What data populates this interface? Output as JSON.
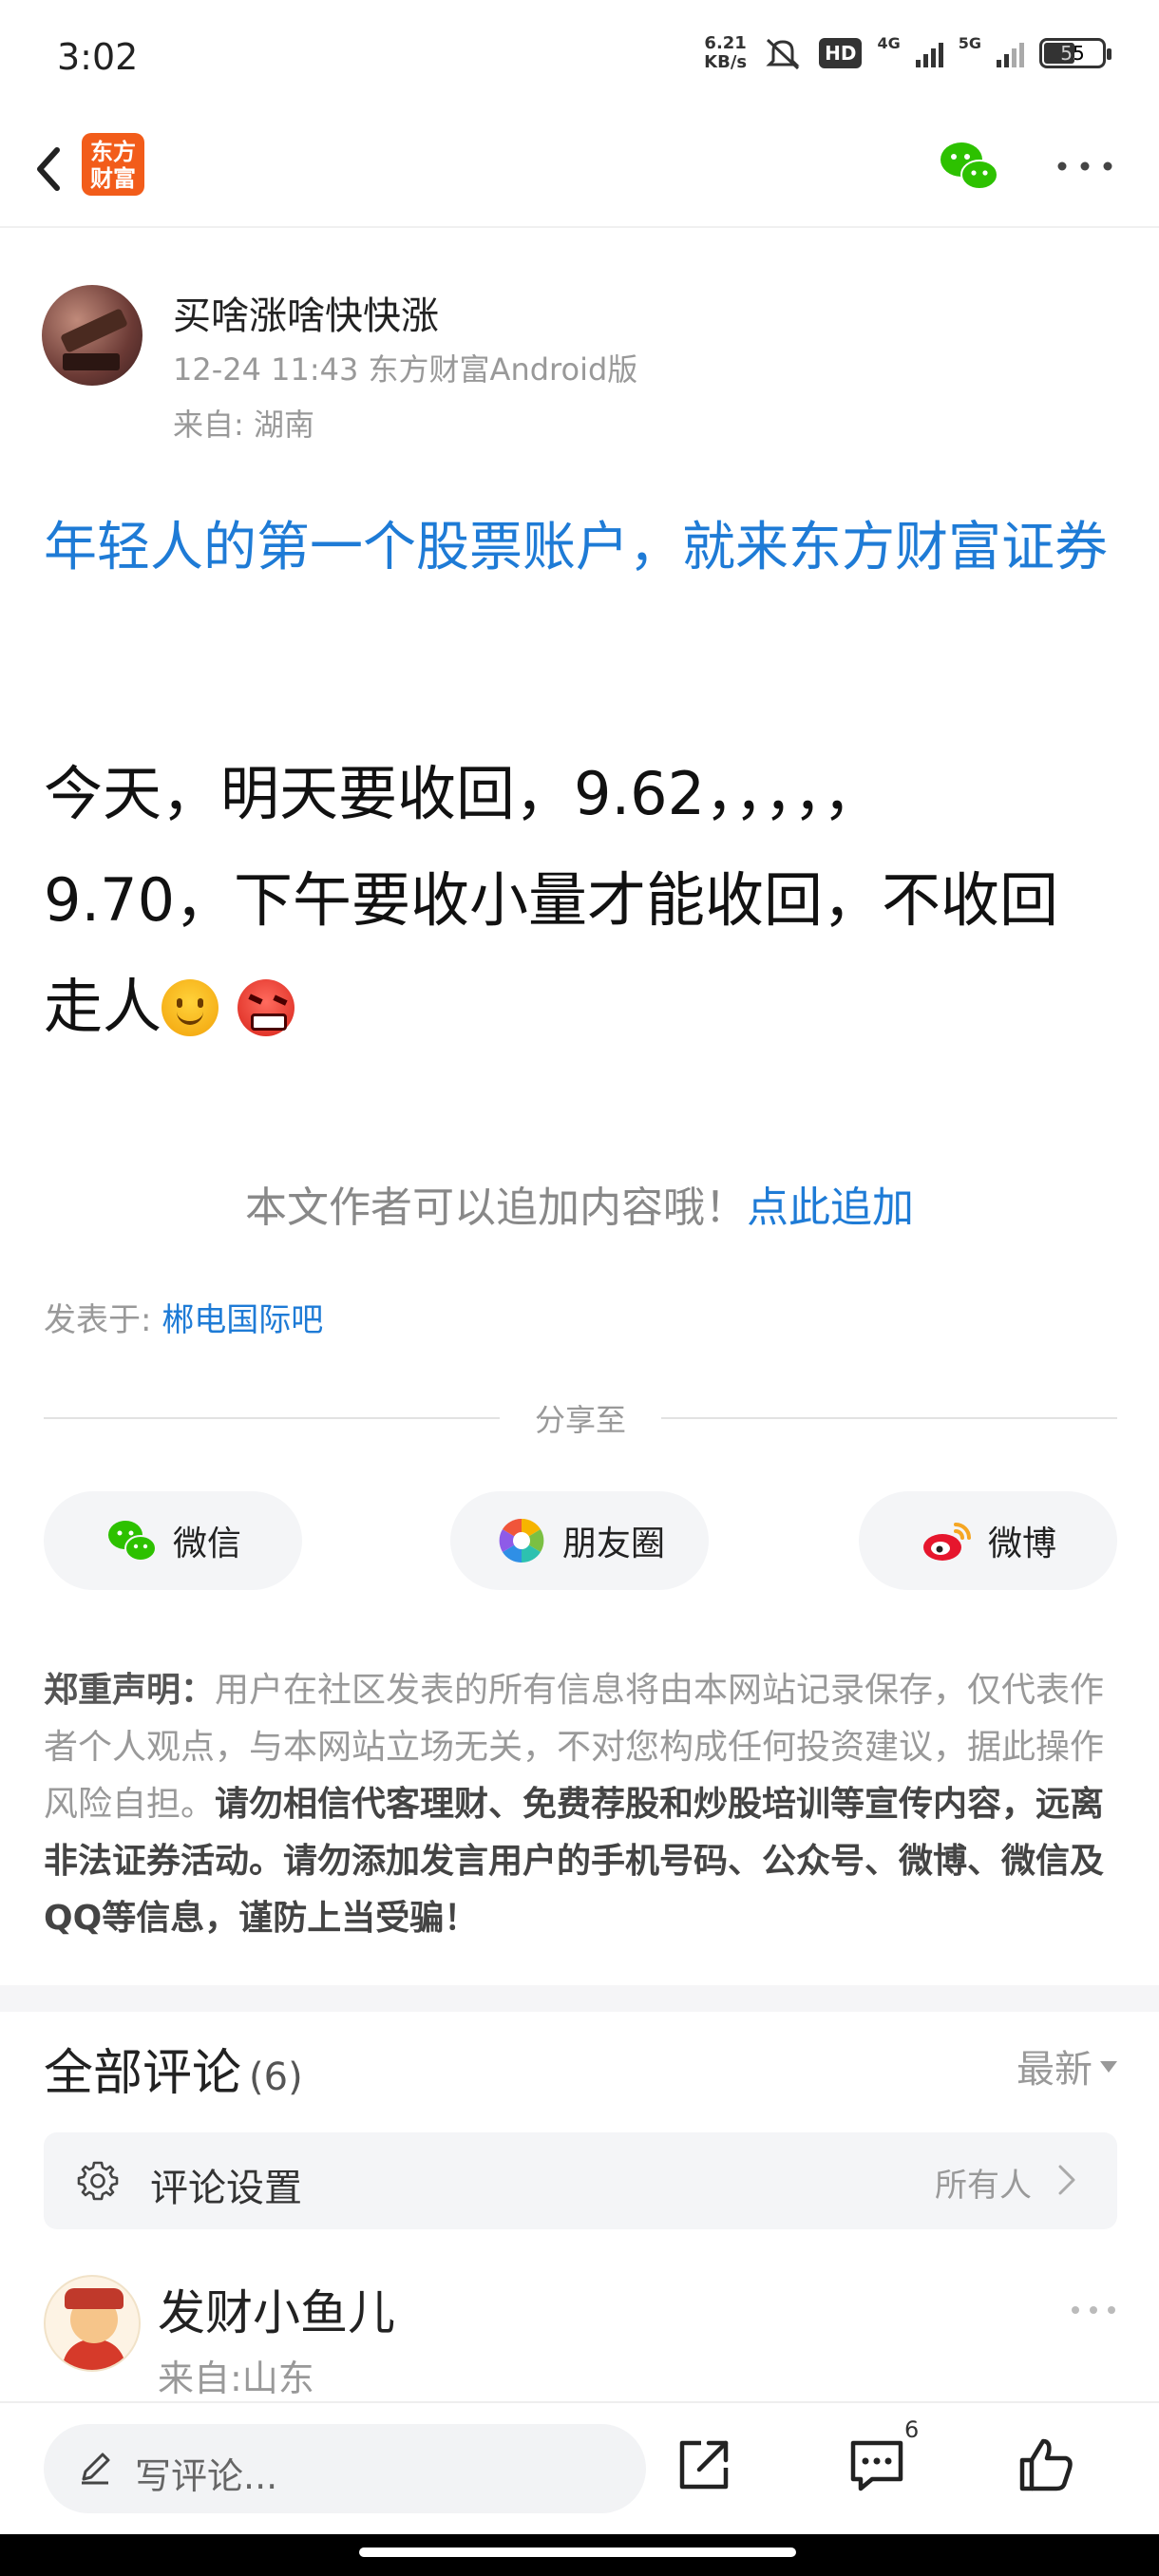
{
  "status_bar": {
    "time": "3:02",
    "net_speed_value": "6.21",
    "net_speed_unit": "KB/s",
    "hd_label": "HD",
    "sim1_label": "4G",
    "sim2_label": "5G",
    "battery": "55"
  },
  "header": {
    "logo_line1": "东方",
    "logo_line2": "财富"
  },
  "post": {
    "author_name": "买啥涨啥快快涨",
    "meta": "12-24 11:43 东方财富Android版",
    "location": "来自: 湖南",
    "ad_title": "年轻人的第一个股票账户，就来东方财富证券",
    "content_line1": "今天，明天要收回，9.62，，，，，",
    "content_line2": "9.70，下午要收小量才能收回，不收回",
    "content_line3": "走人",
    "append_prompt": "本文作者可以追加内容哦！",
    "append_link": "点此追加",
    "posted_in_label": "发表于: ",
    "posted_in_bar": "郴电国际吧"
  },
  "share": {
    "label": "分享至",
    "wechat": "微信",
    "moments": "朋友圈",
    "weibo": "微博"
  },
  "disclaimer": {
    "head": "郑重声明：",
    "normal": "用户在社区发表的所有信息将由本网站记录保存，仅代表作者个人观点，与本网站立场无关，不对您构成任何投资建议，据此操作风险自担。",
    "strong": "请勿相信代客理财、免费荐股和炒股培训等宣传内容，远离非法证券活动。请勿添加发言用户的手机号码、公众号、微博、微信及QQ等信息，谨防上当受骗！"
  },
  "comments": {
    "title": "全部评论",
    "count": "(6)",
    "sort": "最新",
    "setting_label": "评论设置",
    "setting_value": "所有人",
    "items": [
      {
        "name": "发财小鱼儿",
        "location": "来自:山东"
      }
    ]
  },
  "bottom_bar": {
    "write_placeholder": "写评论...",
    "comment_badge": "6"
  },
  "colors": {
    "link_blue": "#1e7bd6",
    "brand_orange": "#f25c1a",
    "wechat_green": "#2dc100"
  }
}
